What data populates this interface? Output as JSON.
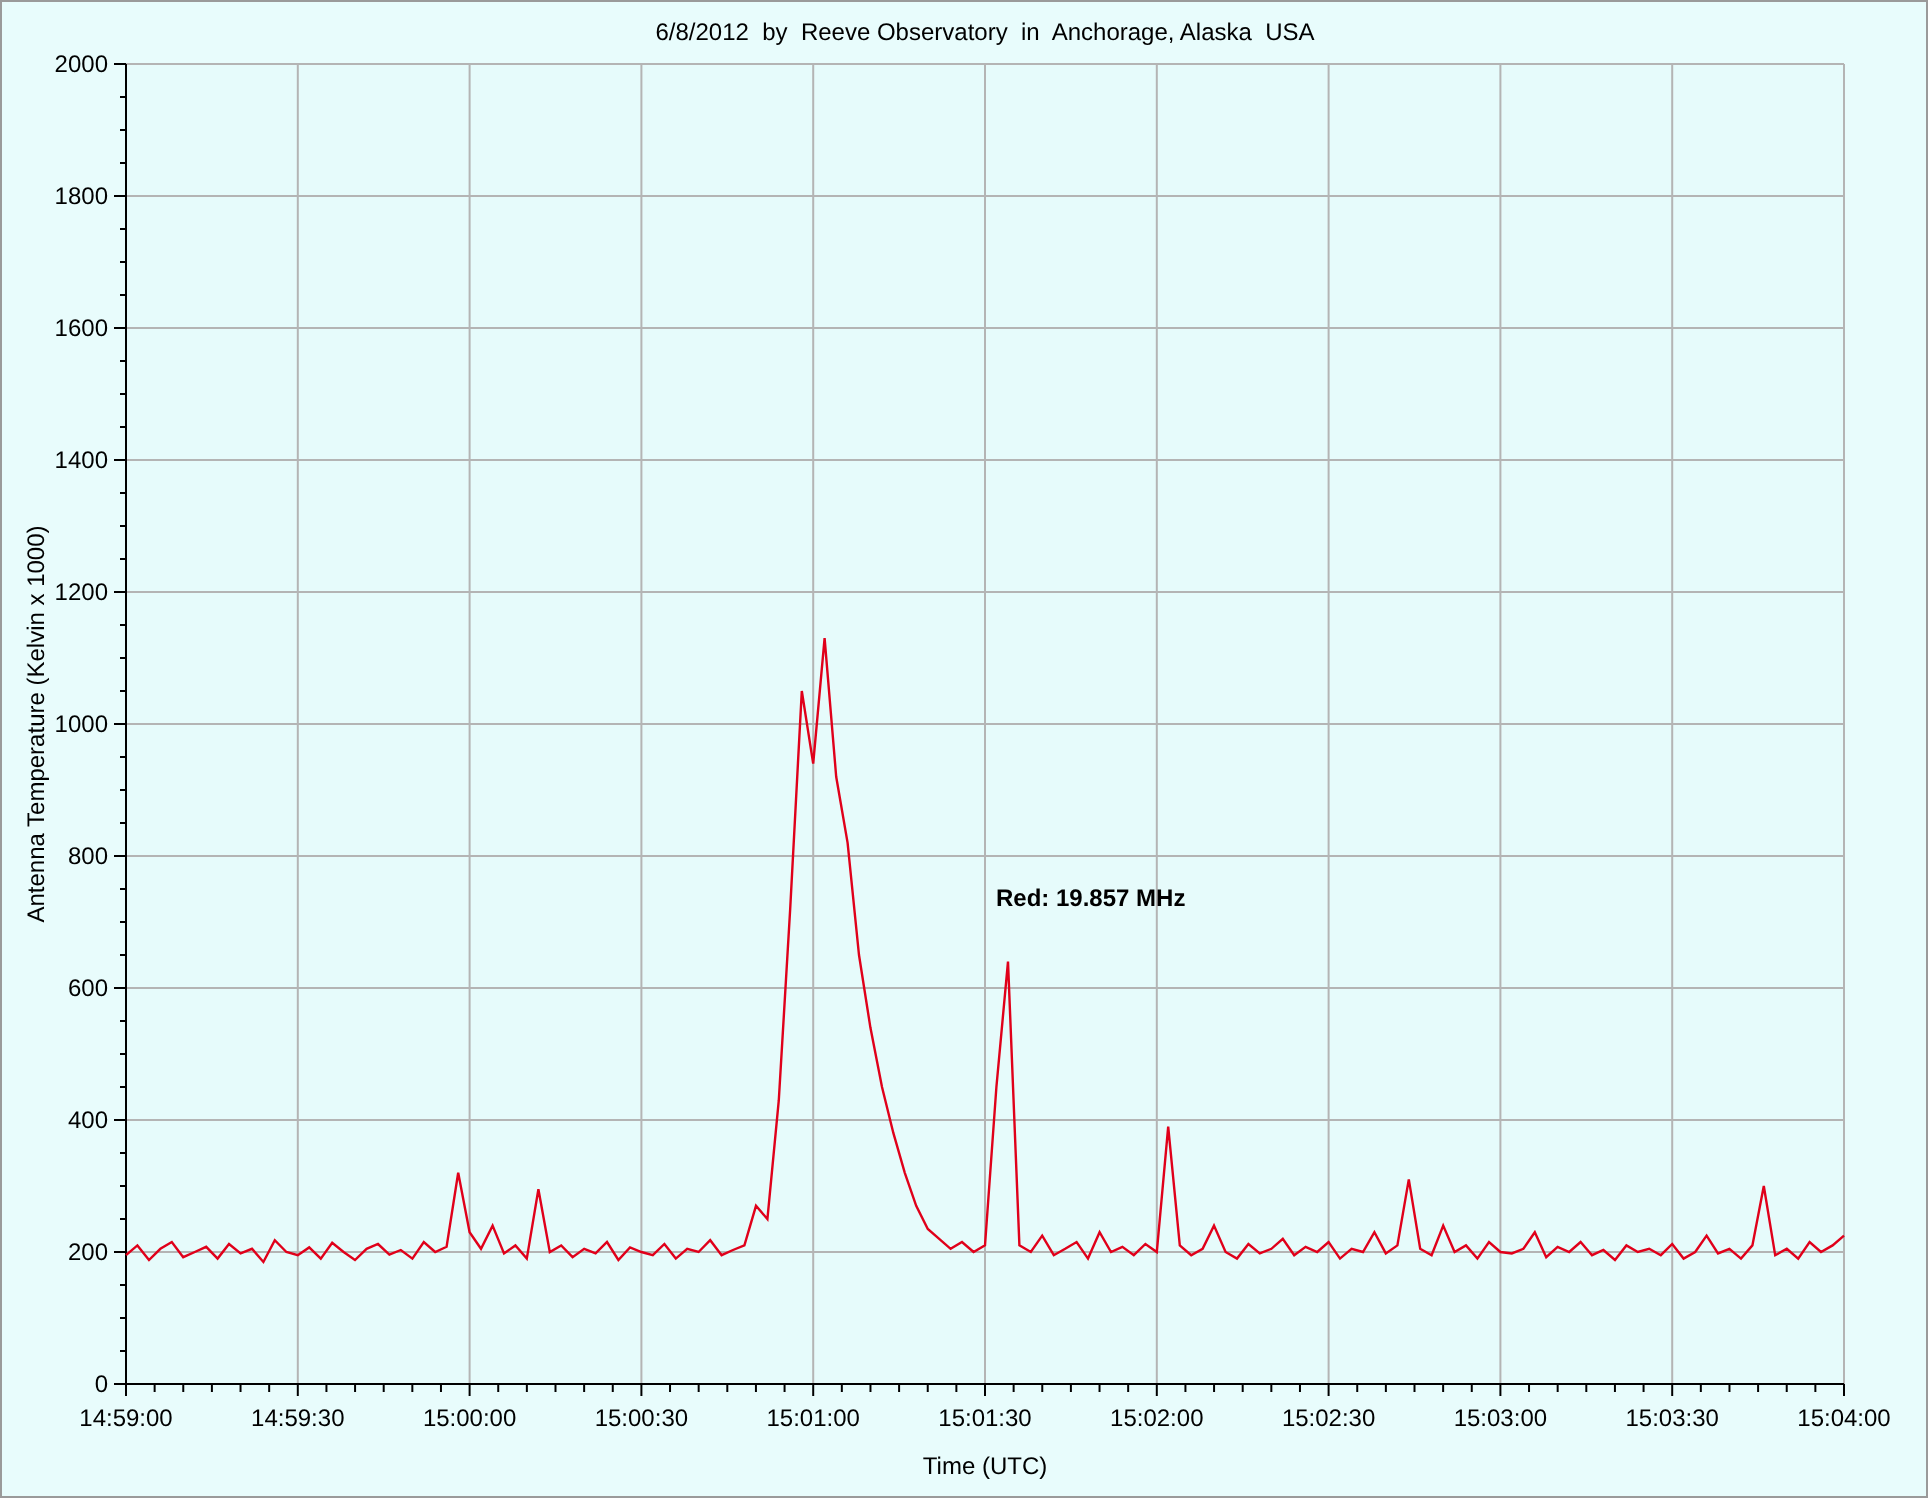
{
  "chart": {
    "chart_data": {
      "type": "line",
      "title": "6/8/2012  by  Reeve Observatory  in  Anchorage, Alaska  USA",
      "xlabel": "Time (UTC)",
      "ylabel": "Antenna Temperature (Kelvin x 1000)",
      "categories": [
        "14:59:00",
        null,
        null,
        null,
        null,
        null,
        null,
        null,
        null,
        null,
        null,
        null,
        null,
        null,
        null,
        "14:59:30",
        null,
        null,
        null,
        null,
        null,
        null,
        null,
        null,
        null,
        null,
        null,
        null,
        null,
        null,
        "15:00:00",
        null,
        null,
        null,
        null,
        null,
        null,
        null,
        null,
        null,
        null,
        null,
        null,
        null,
        null,
        "15:00:30",
        null,
        null,
        null,
        null,
        null,
        null,
        null,
        null,
        null,
        null,
        null,
        null,
        null,
        null,
        "15:01:00",
        null,
        null,
        null,
        null,
        null,
        null,
        null,
        null,
        null,
        null,
        null,
        null,
        null,
        null,
        "15:01:30",
        null,
        null,
        null,
        null,
        null,
        null,
        null,
        null,
        null,
        null,
        null,
        null,
        null,
        null,
        "15:02:00",
        null,
        null,
        null,
        null,
        null,
        null,
        null,
        null,
        null,
        null,
        null,
        null,
        null,
        null,
        "15:02:30",
        null,
        null,
        null,
        null,
        null,
        null,
        null,
        null,
        null,
        null,
        null,
        null,
        null,
        null,
        "15:03:00",
        null,
        null,
        null,
        null,
        null,
        null,
        null,
        null,
        null,
        null,
        null,
        null,
        null,
        null,
        "15:03:30",
        null,
        null,
        null,
        null,
        null,
        null,
        null,
        null,
        null,
        null,
        null,
        null,
        null,
        null,
        "15:04:00"
      ],
      "series": [
        {
          "name": "Red: 19.857 MHz",
          "color": "#e0001a",
          "values": [
            195,
            210,
            188,
            205,
            215,
            192,
            200,
            208,
            190,
            212,
            198,
            205,
            185,
            218,
            200,
            195,
            207,
            190,
            214,
            200,
            188,
            205,
            212,
            196,
            203,
            190,
            215,
            200,
            208,
            320,
            230,
            205,
            240,
            198,
            210,
            190,
            295,
            200,
            210,
            192,
            205,
            198,
            215,
            188,
            207,
            200,
            195,
            212,
            190,
            205,
            200,
            218,
            195,
            203,
            210,
            270,
            250,
            430,
            720,
            1050,
            940,
            1130,
            920,
            820,
            650,
            540,
            450,
            380,
            320,
            270,
            235,
            220,
            205,
            215,
            200,
            210,
            450,
            640,
            210,
            200,
            225,
            195,
            205,
            215,
            190,
            230,
            200,
            208,
            195,
            212,
            200,
            390,
            210,
            195,
            205,
            240,
            200,
            190,
            212,
            198,
            205,
            220,
            195,
            208,
            200,
            215,
            190,
            205,
            200,
            230,
            198,
            210,
            310,
            205,
            195,
            240,
            200,
            210,
            190,
            215,
            200,
            198,
            205,
            230,
            192,
            208,
            200,
            215,
            195,
            203,
            188,
            210,
            200,
            205,
            195,
            212,
            190,
            200,
            225,
            198,
            205,
            190,
            210,
            300,
            195,
            205,
            190,
            215,
            200,
            210,
            225
          ]
        }
      ],
      "ylim": [
        0,
        2000
      ],
      "grid": true,
      "yticks": [
        0,
        200,
        400,
        600,
        800,
        1000,
        1200,
        1400,
        1600,
        1800,
        2000
      ]
    }
  }
}
